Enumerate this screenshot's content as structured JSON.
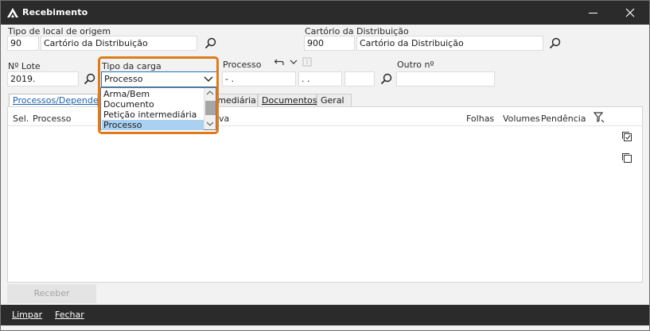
{
  "window": {
    "title": "Recebimento"
  },
  "origem": {
    "label": "Tipo de local de origem",
    "code": "90",
    "name": "Cartório da Distribuição"
  },
  "distribuicao": {
    "label": "Cartório da Distribuição",
    "code": "900",
    "name": "Cartório da Distribuição"
  },
  "lote": {
    "label": "Nº Lote",
    "value": "2019."
  },
  "tipo_carga": {
    "label": "Tipo da carga",
    "selected": "Processo",
    "options": [
      "Arma/Bem",
      "Documento",
      "Petição intermediária",
      "Processo"
    ]
  },
  "processo": {
    "label": "Processo",
    "part1": "-  .",
    "part2": ".  ."
  },
  "outro": {
    "label": "Outro nº"
  },
  "tabs": [
    {
      "label": "Processos/Dependen"
    },
    {
      "label": "rmediária"
    },
    {
      "label": "Documentos"
    },
    {
      "label": "Geral"
    }
  ],
  "grid": {
    "columns": [
      "Sel.",
      "Processo",
      "va",
      "Folhas",
      "Volumes",
      "Pendência"
    ]
  },
  "buttons": {
    "receber": "Receber",
    "limpar": "Limpar",
    "fechar": "Fechar"
  },
  "colors": {
    "titlebar": "#2b2b2b",
    "highlight": "#e07b1a",
    "selection": "#aad1f2",
    "accent": "#1e73be"
  }
}
